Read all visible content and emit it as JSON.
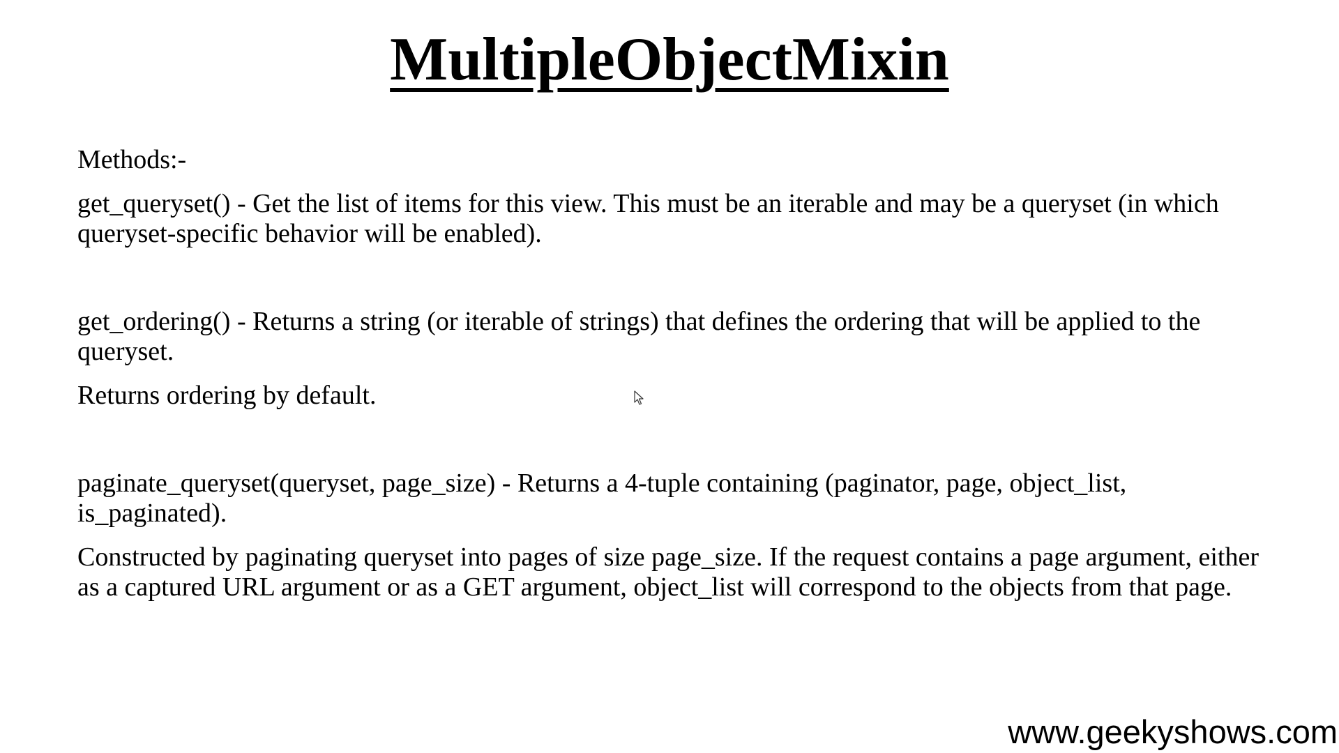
{
  "title": "MultipleObjectMixin",
  "methods_heading": "Methods:-",
  "methods": [
    {
      "description": "get_queryset() - Get the list of items for this view. This must be an iterable and may be a queryset (in which queryset-specific behavior will be enabled)."
    },
    {
      "description": "get_ordering() - Returns a string (or iterable of strings) that defines the ordering that will be applied to the queryset.",
      "note": "Returns ordering by default."
    },
    {
      "description": "paginate_queryset(queryset, page_size) - Returns a 4-tuple containing (paginator, page, object_list, is_paginated).",
      "note": "Constructed by paginating queryset into pages of size page_size. If the request contains a page argument, either as a captured URL argument or as a GET argument, object_list will correspond to the objects from that page."
    }
  ],
  "footer_url": "www.geekyshows.com",
  "cursor_icon": "mouse-pointer-icon"
}
